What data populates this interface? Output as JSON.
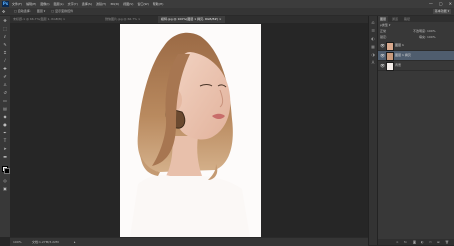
{
  "app": {
    "logo": "Ps"
  },
  "menubar": {
    "items": [
      "文件(F)",
      "编辑(E)",
      "图像(I)",
      "图层(L)",
      "文字(Y)",
      "选择(S)",
      "滤镜(T)",
      "3D(D)",
      "视图(V)",
      "窗口(W)",
      "帮助(H)"
    ],
    "window_controls": [
      "—",
      "▢",
      "✕"
    ]
  },
  "options_bar": {
    "items": [
      "□ 自动选择:",
      "图层 ▾",
      "□ 显示变换控件"
    ],
    "workspace": "基本功能 ▾"
  },
  "document": {
    "tabs": [
      {
        "label": "未标题-1 @ 66.7%(图层 1, RGB/8) ×",
        "active": false
      },
      {
        "label": "微信图片.jpg @ 66.7% ×",
        "active": false
      },
      {
        "label": "模特.jpg @ 100%(图层 1 拷贝, RGB/8#) ×",
        "active": true
      }
    ]
  },
  "statusbar": {
    "zoom": "100%",
    "doc_info": "文档:1.27M/3.22M",
    "arrow": "▸"
  },
  "layers_panel": {
    "tabs": {
      "active": "图层",
      "inactive": [
        "通道",
        "路径"
      ]
    },
    "filter_label": "ρ类型 ▾",
    "blend_mode": "正常",
    "opacity_label": "不透明度: 100%",
    "lock_label": "锁定:",
    "fill_label": "填充: 100%",
    "layers": [
      {
        "name": "图层 1",
        "selected": false
      },
      {
        "name": "图层 1 拷贝",
        "selected": true
      },
      {
        "name": "背景",
        "selected": false
      }
    ],
    "footer_icons": [
      "link-icon",
      "fx-icon",
      "mask-icon",
      "adjustment-icon",
      "folder-icon",
      "new-layer-icon",
      "trash-icon"
    ]
  },
  "colors": {
    "workspace_bg": "#262626",
    "panel_bg": "#383838",
    "selected_layer": "#4f5d6e",
    "artboard_bg": "#fdfbfa"
  }
}
